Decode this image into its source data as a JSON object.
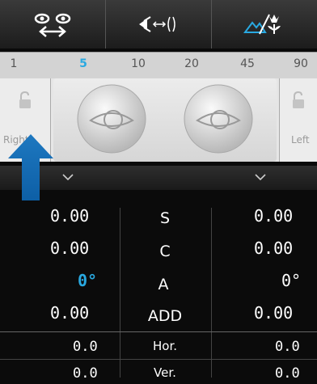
{
  "toolbar": {
    "buttons": [
      {
        "name": "pd-button",
        "icon": "eyes-pupillary-distance-icon"
      },
      {
        "name": "distance-button",
        "icon": "chart-distance-icon"
      },
      {
        "name": "mode-button",
        "icon": "landscape-flower-icon"
      }
    ]
  },
  "scale": {
    "ticks": [
      "1",
      "5",
      "10",
      "20",
      "45",
      "90"
    ],
    "active": "5",
    "active_color": "#29a9e1"
  },
  "eyes": {
    "right_label": "Right",
    "left_label": "Left"
  },
  "table": {
    "rows": [
      {
        "right": "0.00",
        "label": "S",
        "left": "0.00"
      },
      {
        "right": "0.00",
        "label": "C",
        "left": "0.00"
      },
      {
        "right": "0°",
        "label": "A",
        "left": "0°"
      },
      {
        "right": "0.00",
        "label": "ADD",
        "left": "0.00"
      }
    ],
    "prism_rows": [
      {
        "right": "0.0",
        "label": "Hor.",
        "left": "0.0"
      },
      {
        "right": "0.0",
        "label": "Ver.",
        "left": "0.0"
      }
    ]
  },
  "colors": {
    "accent": "#29a9e1",
    "arrow": "#1f7fc4"
  }
}
